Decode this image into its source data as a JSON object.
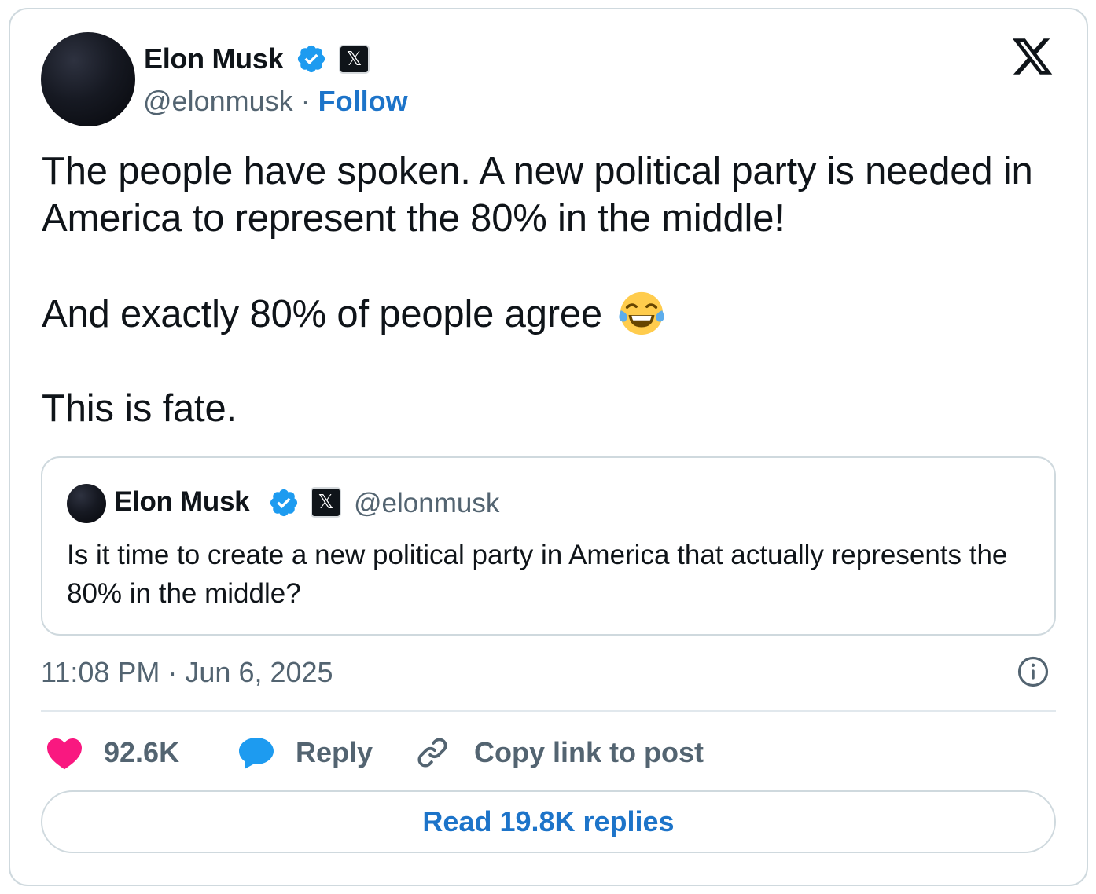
{
  "author": {
    "name": "Elon Musk",
    "handle": "@elonmusk",
    "separator": "·",
    "follow_label": "Follow",
    "verified_color": "#1d9bf0",
    "badge_glyph": "𝕏"
  },
  "tweet": {
    "paragraphs": [
      "The people have spoken. A new political party is needed in America to represent the 80% in the middle!",
      "And exactly 80% of people agree",
      "This is fate."
    ],
    "emoji": "face-with-tears-of-joy"
  },
  "quoted_tweet": {
    "name": "Elon Musk",
    "handle": "@elonmusk",
    "badge_glyph": "𝕏",
    "text": "Is it time to create a new political party in America that actually represents the 80% in the middle?"
  },
  "timestamp": "11:08 PM · Jun 6, 2025",
  "actions": {
    "likes": "92.6K",
    "reply_label": "Reply",
    "copy_label": "Copy link to post",
    "read_replies_label": "Read 19.8K replies"
  },
  "colors": {
    "link_blue": "#1d74c9",
    "heart_pink": "#f91880",
    "reply_blue": "#1d9bf0",
    "muted_text": "#536471",
    "border": "#cfd9de"
  }
}
